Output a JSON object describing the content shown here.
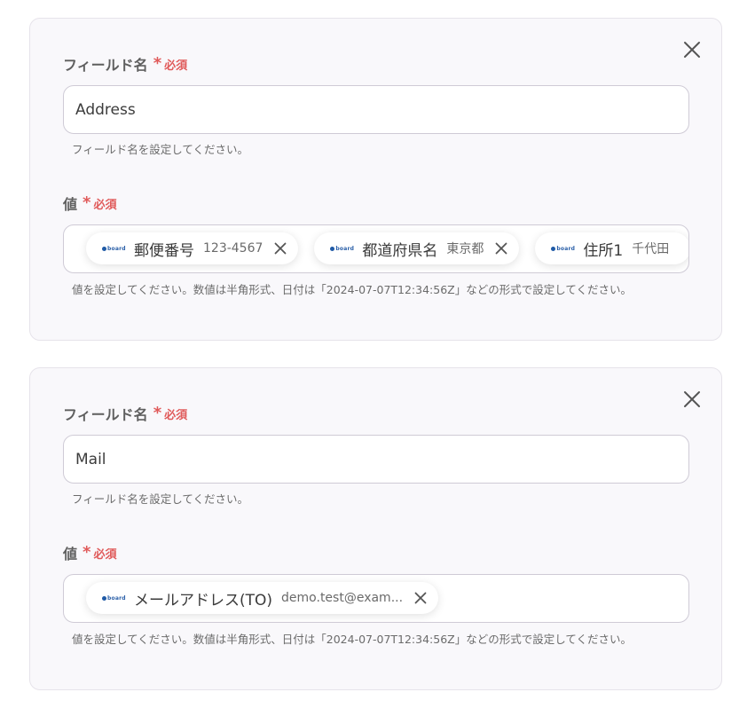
{
  "cards": [
    {
      "field_label": "フィールド名",
      "required_mark": "*",
      "required_text": "必須",
      "field_value": "Address",
      "field_help": "フィールド名を設定してください。",
      "value_label": "値",
      "value_help": "値を設定してください。数値は半角形式、日付は「2024-07-07T12:34:56Z」などの形式で設定してください。",
      "chips": [
        {
          "logo": "board",
          "name": "郵便番号",
          "value": "123-4567"
        },
        {
          "logo": "board",
          "name": "都道府県名",
          "value": "東京都"
        },
        {
          "logo": "board",
          "name": "住所1",
          "value": "千代田"
        }
      ]
    },
    {
      "field_label": "フィールド名",
      "required_mark": "*",
      "required_text": "必須",
      "field_value": "Mail",
      "field_help": "フィールド名を設定してください。",
      "value_label": "値",
      "value_help": "値を設定してください。数値は半角形式、日付は「2024-07-07T12:34:56Z」などの形式で設定してください。",
      "chips": [
        {
          "logo": "board",
          "name": "メールアドレス(TO)",
          "value": "demo.test@exam..."
        }
      ]
    }
  ],
  "icons": {
    "close": "close-icon",
    "chip_remove": "close-icon",
    "app_logo": "board-logo-icon"
  },
  "colors": {
    "required": "#e05a5a",
    "logo": "#1f5aa6"
  }
}
